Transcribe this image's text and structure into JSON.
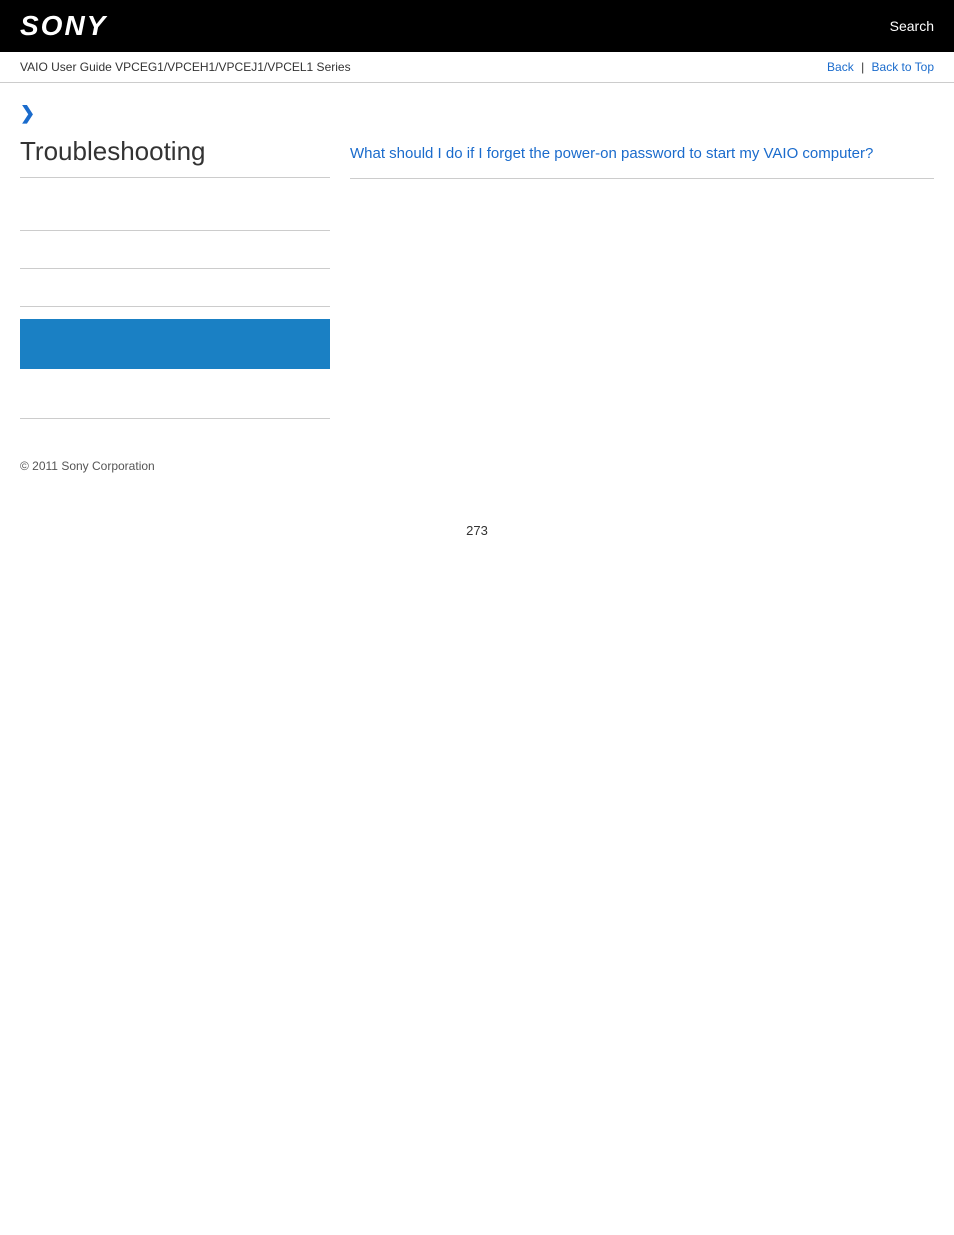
{
  "header": {
    "logo": "SONY",
    "search_label": "Search"
  },
  "breadcrumb": {
    "guide_title": "VAIO User Guide VPCEG1/VPCEH1/VPCEJ1/VPCEL1 Series",
    "back_label": "Back",
    "back_to_top_label": "Back to Top"
  },
  "sidebar": {
    "chevron": "❯",
    "title": "Troubleshooting",
    "blank_items": [
      "",
      "",
      ""
    ],
    "highlight_box": true,
    "extra_blank": ""
  },
  "content": {
    "link_text": "What should I do if I forget the power-on password to start my VAIO computer?"
  },
  "footer": {
    "copyright": "© 2011 Sony Corporation"
  },
  "page": {
    "number": "273"
  }
}
